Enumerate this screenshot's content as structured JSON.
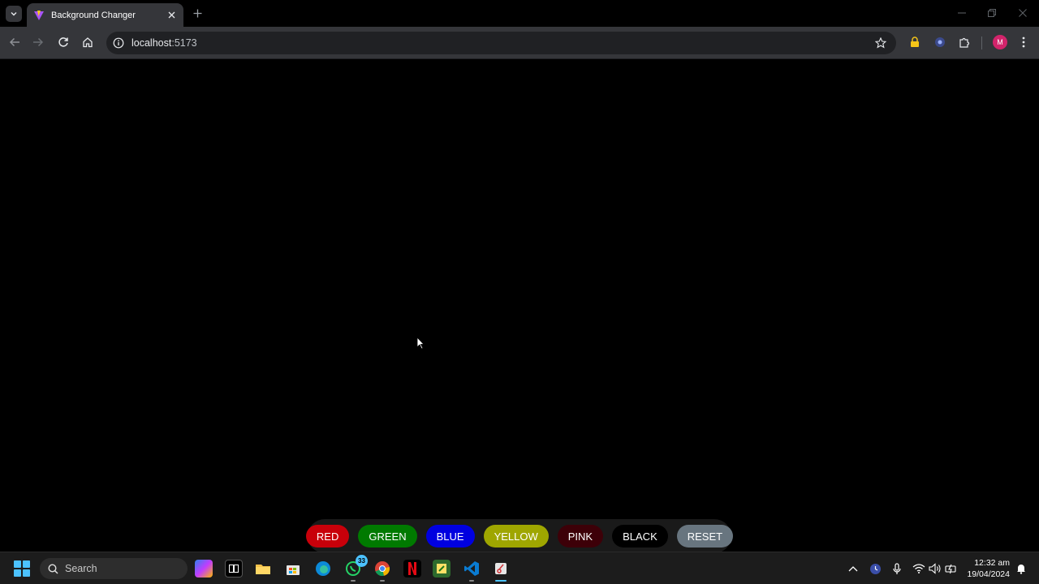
{
  "browser": {
    "tab_title": "Background Changer",
    "url_host": "localhost",
    "url_port": ":5173",
    "profile_initial": "M"
  },
  "page": {
    "background_color": "#000000",
    "buttons": [
      {
        "label": "RED",
        "color": "#c8000a"
      },
      {
        "label": "GREEN",
        "color": "#007a00"
      },
      {
        "label": "BLUE",
        "color": "#0000e0"
      },
      {
        "label": "YELLOW",
        "color": "#9fa600"
      },
      {
        "label": "PINK",
        "color": "#3d0008"
      },
      {
        "label": "BLACK",
        "color": "#000000"
      },
      {
        "label": "RESET",
        "color": "#68757f"
      }
    ]
  },
  "taskbar": {
    "search_placeholder": "Search",
    "whatsapp_badge": "33",
    "time": "12:32 am",
    "date": "19/04/2024"
  }
}
